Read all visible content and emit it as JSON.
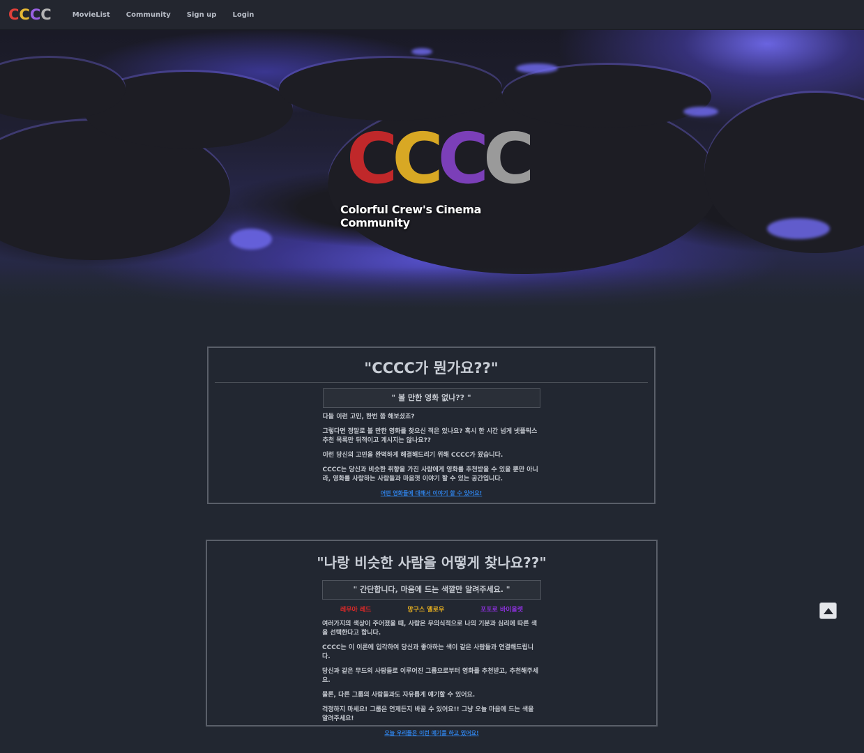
{
  "nav": {
    "logo_letters": [
      "C",
      "C",
      "C",
      "C"
    ],
    "links": [
      "MovieList",
      "Community",
      "Sign up",
      "Login"
    ]
  },
  "hero": {
    "logo_letters": [
      "C",
      "C",
      "C",
      "C"
    ],
    "tagline": "Colorful Crew's Cinema Community"
  },
  "section1": {
    "title": "\"CCCC가 뭔가요??\"",
    "subtitle": "\" 볼 만한 영화 없나?? \"",
    "paragraphs": [
      "다들 이런 고민, 한번 쯤 해보셨죠?",
      "그렇다면 정말로 볼 만한 영화를 찾으신 적은 있나요? 혹시 한 시간 넘게 넷플릭스 추천 목록만 뒤적이고 계시지는 않나요??",
      "이런 당신의 고민을 완벽하게 해결해드리기 위해 CCCC가 왔습니다.",
      "CCCC는 당신과 비슷한 취향을 가진 사람에게 영화를 추천받을 수 있을 뿐만 아니라, 영화를 사랑하는 사람들과 마음껏 이야기 할 수 있는 공간입니다."
    ],
    "link": "어떤 영화들에 대해서 이야기 할 수 있어요!"
  },
  "section2": {
    "title": "\"나랑 비슷한 사람을 어떻게 찾나요??\"",
    "subtitle": "\" 간단합니다, 마음에 드는 색깔만 알려주세요. \"",
    "colors": [
      "레무아 레드",
      "망구스 옐로우",
      "포포로 바이올렛"
    ],
    "paragraphs": [
      "여러가지의 색상이 주어졌을 때, 사람은 무의식적으로 나의 기분과 심리에 따른 색을 선택한다고 합니다.",
      "CCCC는 이 이론에 입각하여 당신과 좋아하는 색이 같은 사람들과 연결해드립니다.",
      "당신과 같은 무드의 사람들로 이루어진 그룹으로부터 영화를 추천받고, 추천해주세요.",
      "물론, 다른 그룹의 사람들과도 자유롭게 얘기할 수 있어요.",
      "걱정하지 마세요! 그룹은 언제든지 바꿀 수 있어요!! 그냥 오늘 마음에 드는 색을 알려주세요!"
    ],
    "link": "오늘 우리들은 이런 얘기를 하고 있어요!"
  },
  "colors": {
    "red": "#c0282a",
    "yellow": "#d8a824",
    "violet": "#7b3fb8",
    "gray": "#9a9a9a",
    "link": "#2f7fe0",
    "background": "#222731"
  },
  "scroll_top_icon": "chevron-up-icon"
}
